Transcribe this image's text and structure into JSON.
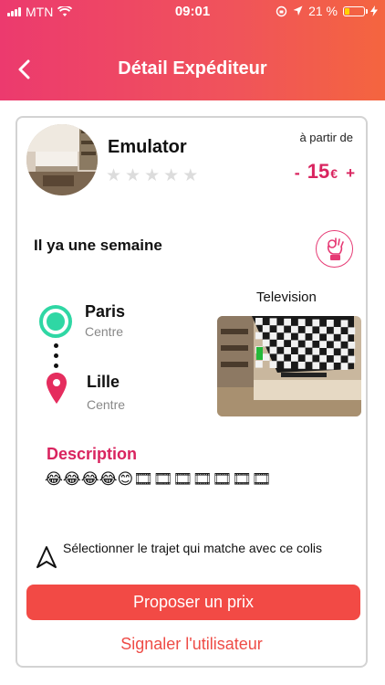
{
  "status_bar": {
    "carrier": "MTN",
    "time": "09:01",
    "battery": "21 %",
    "battery_level": 0.21
  },
  "header": {
    "title": "Détail Expéditeur",
    "back_icon": "chevron-left-icon"
  },
  "sender": {
    "name": "Emulator",
    "rating": 0,
    "max_rating": 5,
    "price_prefix": "à partir de",
    "price_minus": "-",
    "price_amount": "15",
    "price_currency": "€",
    "price_plus": "+"
  },
  "posted": "Il ya une semaine",
  "route": {
    "departure_city": "Paris",
    "departure_area": "Centre",
    "arrival_city": "Lille",
    "arrival_area": "Centre"
  },
  "item": {
    "name": "Television"
  },
  "description": {
    "title": "Description",
    "text": "😂😂😂😂😊🎞🎞🎞🎞🎞🎞🎞"
  },
  "hint": "Sélectionner le trajet qui matche avec ce colis",
  "actions": {
    "propose": "Proposer un prix",
    "report": "Signaler l'utilisateur"
  },
  "colors": {
    "accent": "#d9245f",
    "button": "#f24a45",
    "teal": "#2fd7a4"
  }
}
